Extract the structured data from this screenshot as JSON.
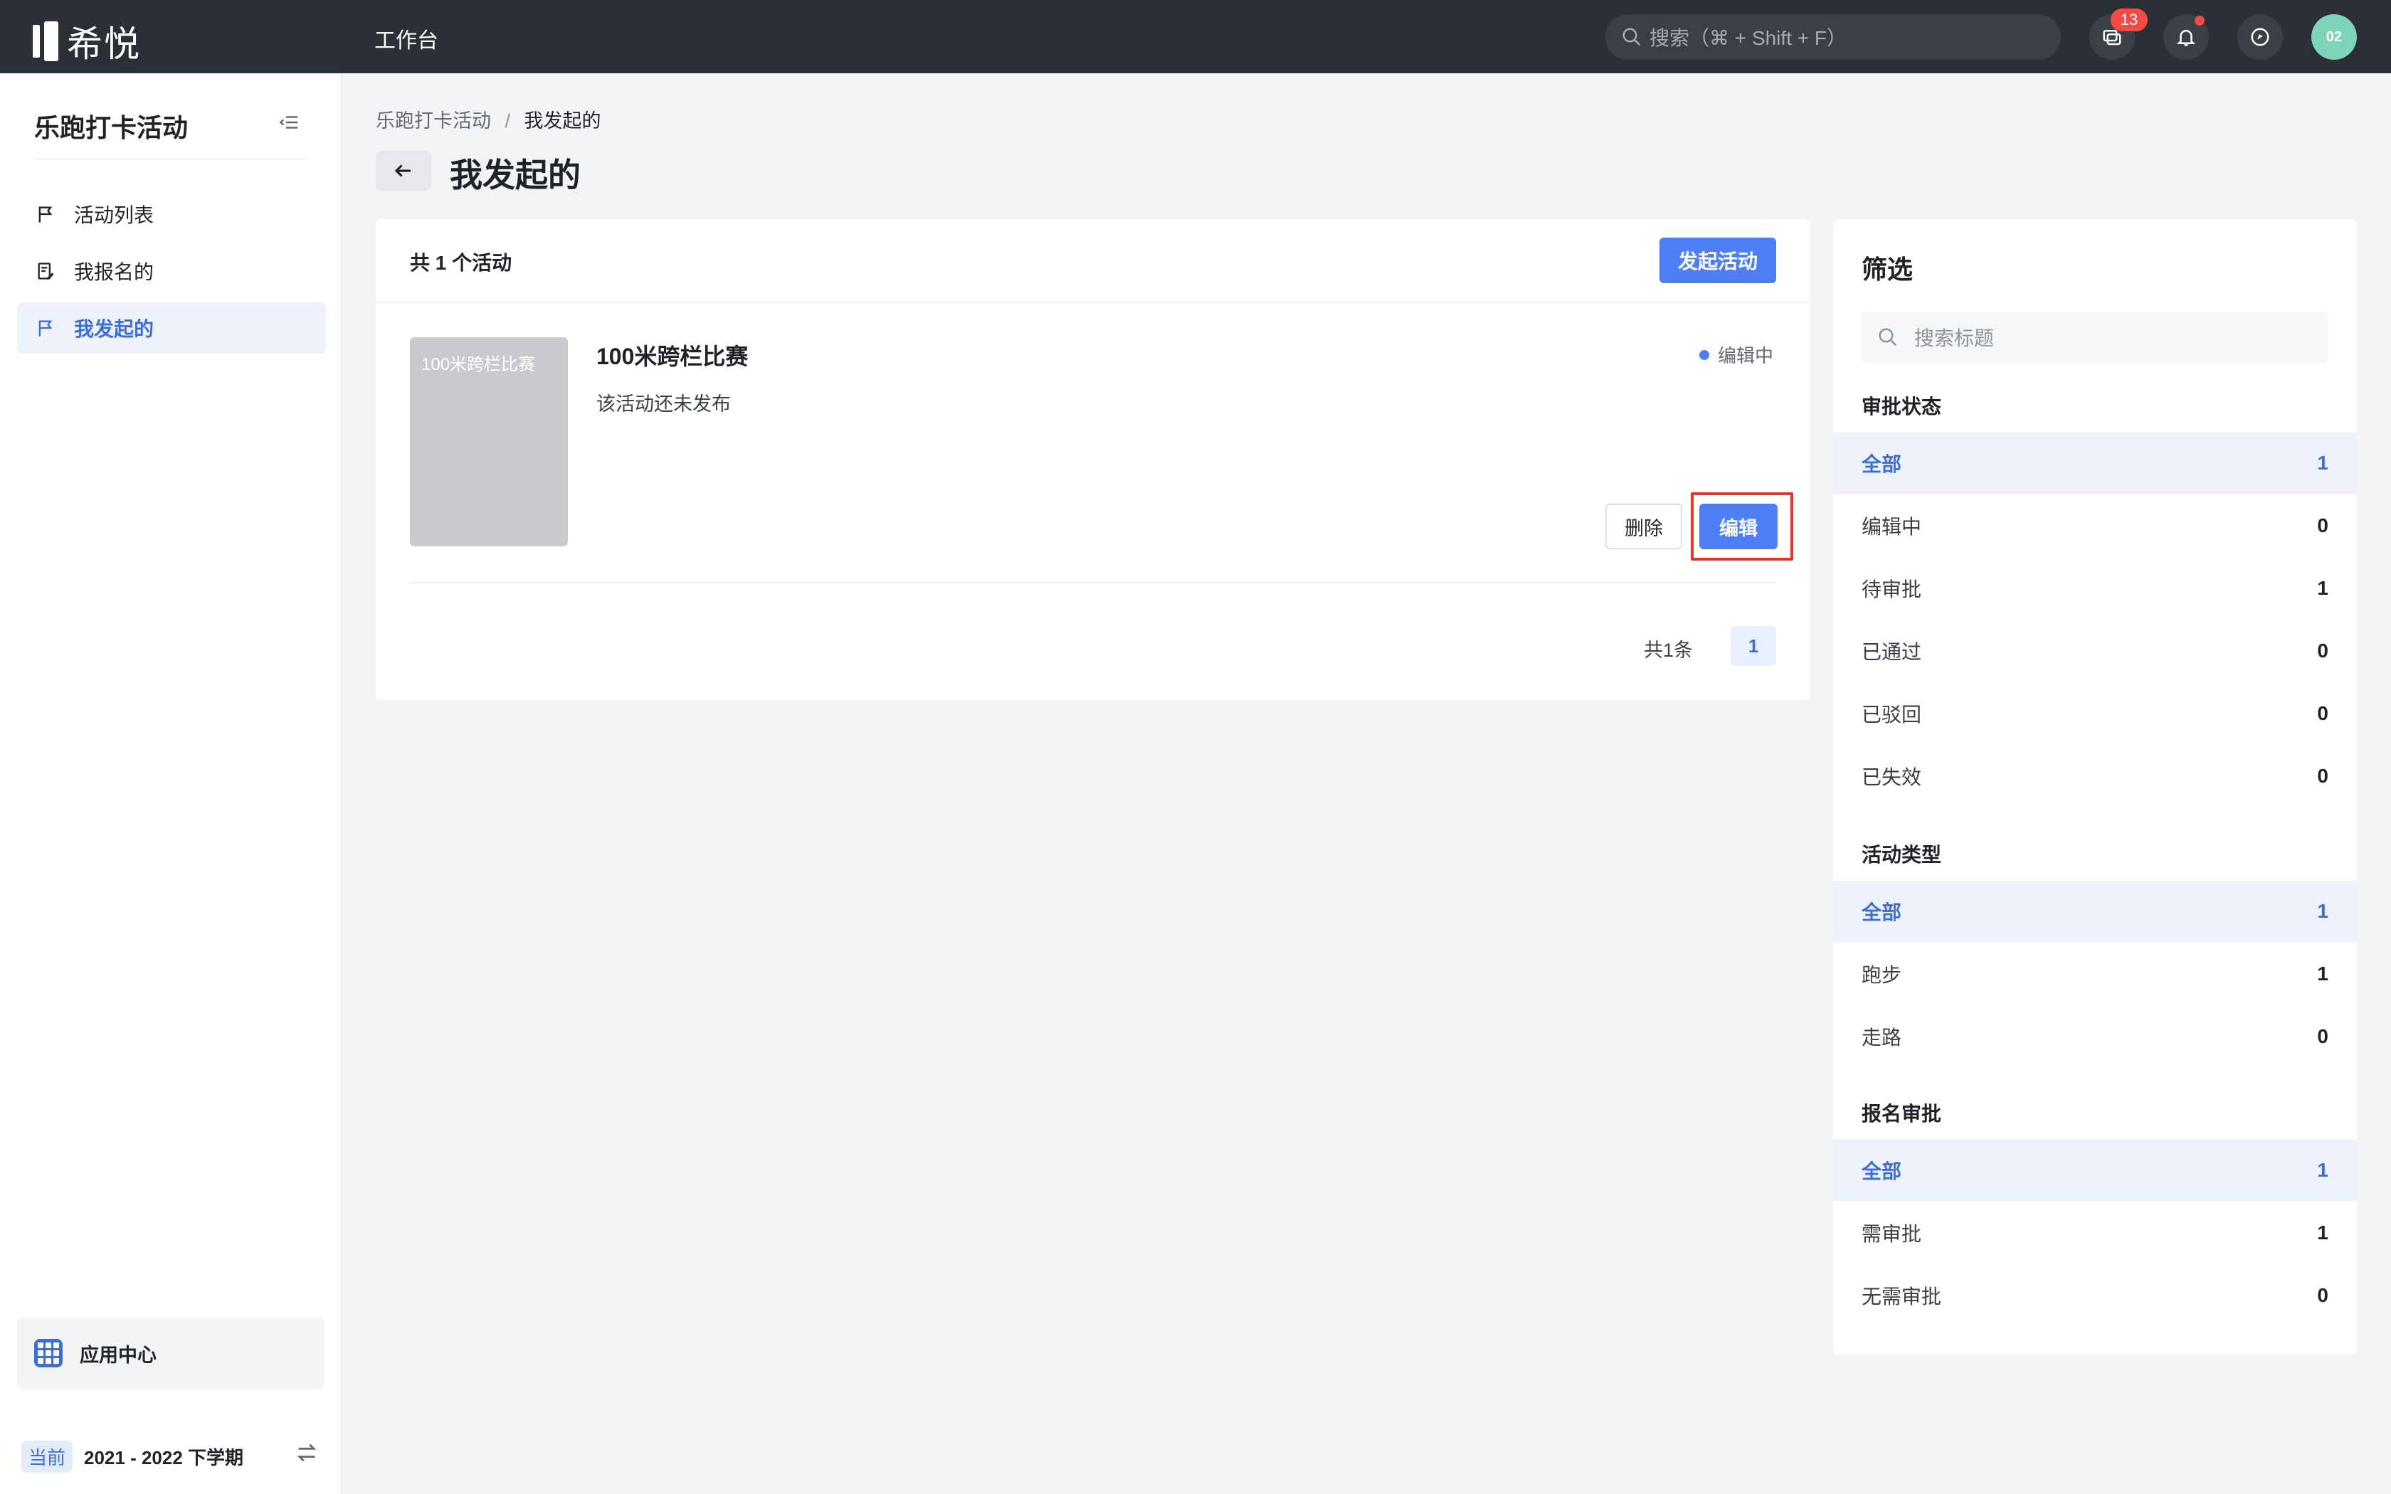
{
  "brand": {
    "logo_text": "希悦"
  },
  "topbar": {
    "tab_label": "工作台",
    "search_placeholder": "搜索（⌘ + Shift + F）",
    "message_badge": "13",
    "avatar_text": "02"
  },
  "sidebar": {
    "title": "乐跑打卡活动",
    "items": [
      {
        "label": "活动列表",
        "icon": "flag-icon"
      },
      {
        "label": "我报名的",
        "icon": "edit-doc-icon"
      },
      {
        "label": "我发起的",
        "icon": "flag-icon",
        "active": true
      }
    ],
    "app_center_label": "应用中心",
    "semester_tag": "当前",
    "semester_label": "2021 - 2022 下学期"
  },
  "breadcrumb": {
    "parent": "乐跑打卡活动",
    "separator": "/",
    "current": "我发起的"
  },
  "page_title": "我发起的",
  "list": {
    "total_label": "共 1 个活动",
    "create_button": "发起活动",
    "items": [
      {
        "thumb_text": "100米跨栏比赛",
        "title": "100米跨栏比赛",
        "description": "该活动还未发布",
        "status": "编辑中",
        "delete_label": "删除",
        "edit_label": "编辑"
      }
    ],
    "pagination": {
      "total": "共1条",
      "current_page": "1"
    }
  },
  "filter": {
    "title": "筛选",
    "search_placeholder": "搜索标题",
    "sections": [
      {
        "title": "审批状态",
        "options": [
          {
            "label": "全部",
            "count": "1",
            "selected": true
          },
          {
            "label": "编辑中",
            "count": "0"
          },
          {
            "label": "待审批",
            "count": "1"
          },
          {
            "label": "已通过",
            "count": "0"
          },
          {
            "label": "已驳回",
            "count": "0"
          },
          {
            "label": "已失效",
            "count": "0"
          }
        ]
      },
      {
        "title": "活动类型",
        "options": [
          {
            "label": "全部",
            "count": "1",
            "selected": true
          },
          {
            "label": "跑步",
            "count": "1"
          },
          {
            "label": "走路",
            "count": "0"
          }
        ]
      },
      {
        "title": "报名审批",
        "options": [
          {
            "label": "全部",
            "count": "1",
            "selected": true
          },
          {
            "label": "需审批",
            "count": "1"
          },
          {
            "label": "无需审批",
            "count": "0"
          }
        ]
      }
    ]
  },
  "colors": {
    "accent": "#4e7ef6",
    "topbar_bg": "#2b2f36",
    "highlight": "#e5352b",
    "badge": "#f54a45"
  }
}
